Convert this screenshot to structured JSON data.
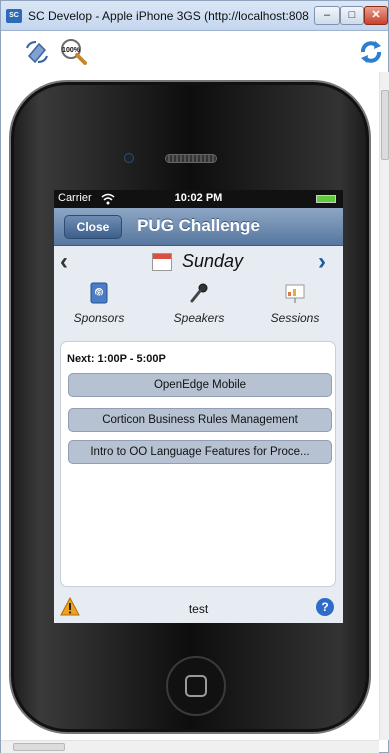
{
  "window": {
    "title": "SC Develop - Apple iPhone 3GS (http://localhost:808...",
    "app_icon": "SC",
    "minimize": "‒",
    "maximize": "□",
    "close": "✕"
  },
  "toolbar": {
    "zoom_label": "100%",
    "icons": [
      "rotate-icon",
      "zoom-icon",
      "refresh-icon"
    ]
  },
  "status_bar": {
    "carrier": "Carrier",
    "time": "10:02 PM"
  },
  "nav_bar": {
    "close_label": "Close",
    "title": "PUG Challenge"
  },
  "day_bar": {
    "prev": "‹",
    "next": "›",
    "day": "Sunday"
  },
  "tabs": [
    {
      "label": "Sponsors",
      "icon": "address-book-icon"
    },
    {
      "label": "Speakers",
      "icon": "microphone-icon"
    },
    {
      "label": "Sessions",
      "icon": "presentation-icon"
    }
  ],
  "panel": {
    "next_label": "Next:  1:00P - 5:00P",
    "items": [
      "OpenEdge Mobile",
      "Corticon Business Rules Management",
      "Intro to OO Language Features for Proce..."
    ]
  },
  "bottom_bar": {
    "text": "test",
    "help": "?"
  },
  "colors": {
    "nav_bar": "#5777a0",
    "item_bg": "#b6c2d2",
    "help_blue": "#2f6cc9",
    "warning": "#f0a020"
  }
}
